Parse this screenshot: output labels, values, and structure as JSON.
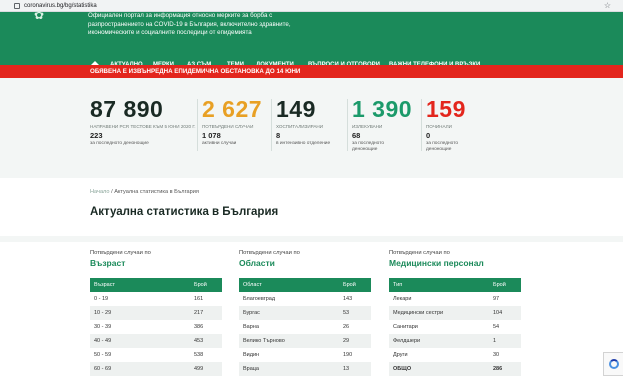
{
  "browser": {
    "url": "coronavirus.bg/bg/statistika"
  },
  "header": {
    "line1": "Официален портал за информация относно мерките за борба с",
    "line2": "разпространението на COVID-19 в България, включително здравните,",
    "line3": "икономическите и социалните последици от епидемията"
  },
  "nav": {
    "items": [
      "АКТУАЛНО",
      "МЕРКИ",
      "АЗ СЪМ...",
      "ТЕМИ",
      "ДОКУМЕНТИ",
      "ВЪПРОСИ И ОТГОВОРИ",
      "ВАЖНИ ТЕЛЕФОНИ И ВРЪЗКИ"
    ]
  },
  "alert": "ОБЯВЕНА Е ИЗВЪНРЕДНА ЕПИДЕМИЧНА ОБСТАНОВКА ДО 14 ЮНИ",
  "stats": [
    {
      "value": "87 890",
      "label": "НАПРАВЕНИ PCR ТЕСТОВЕ КЪМ 5 ЮНИ 2020 Г.",
      "sub": "223",
      "sub_label": "за последното денонощие",
      "color": "#1a2a24"
    },
    {
      "value": "2 627",
      "label": "ПОТВЪРДЕНИ СЛУЧАИ",
      "sub": "1 078",
      "sub_label": "активни случаи",
      "color": "#e8a024"
    },
    {
      "value": "149",
      "label": "ХОСПИТАЛИЗИРАНИ",
      "sub": "8",
      "sub_label": "в интензивно отделение",
      "color": "#1a2a24"
    },
    {
      "value": "1 390",
      "label": "ИЗЛЕКУВАНИ",
      "sub": "68",
      "sub_label": "за последното денонощие",
      "color": "#1b9a6a"
    },
    {
      "value": "159",
      "label": "ПОЧИНАЛИ",
      "sub": "0",
      "sub_label": "за последното денонощие",
      "color": "#e3261d"
    }
  ],
  "breadcrumb": {
    "home": "Начало",
    "sep": "/",
    "current": "Актуална статистика в България"
  },
  "page_title": "Актуална статистика в България",
  "panels": [
    {
      "caption": "Потвърдени случаи по",
      "title": "Възраст",
      "headers": [
        "Възраст",
        "Брой"
      ],
      "rows": [
        [
          "0 - 19",
          "161"
        ],
        [
          "10 - 29",
          "217"
        ],
        [
          "30 - 39",
          "386"
        ],
        [
          "40 - 49",
          "453"
        ],
        [
          "50 - 59",
          "538"
        ],
        [
          "60 - 69",
          "499"
        ]
      ]
    },
    {
      "caption": "Потвърдени случаи по",
      "title": "Области",
      "headers": [
        "Област",
        "Брой"
      ],
      "rows": [
        [
          "Благоевград",
          "143"
        ],
        [
          "Бургас",
          "53"
        ],
        [
          "Варна",
          "26"
        ],
        [
          "Велико Търново",
          "29"
        ],
        [
          "Видин",
          "190"
        ],
        [
          "Враца",
          "13"
        ]
      ]
    },
    {
      "caption": "Потвърдени случаи по",
      "title": "Медицински персонал",
      "headers": [
        "Тип",
        "Брой"
      ],
      "rows": [
        [
          "Лекари",
          "97"
        ],
        [
          "Медицински сестри",
          "104"
        ],
        [
          "Санитари",
          "54"
        ],
        [
          "Фелдшери",
          "1"
        ],
        [
          "Други",
          "30"
        ],
        [
          "ОБЩО",
          "286"
        ]
      ]
    }
  ]
}
